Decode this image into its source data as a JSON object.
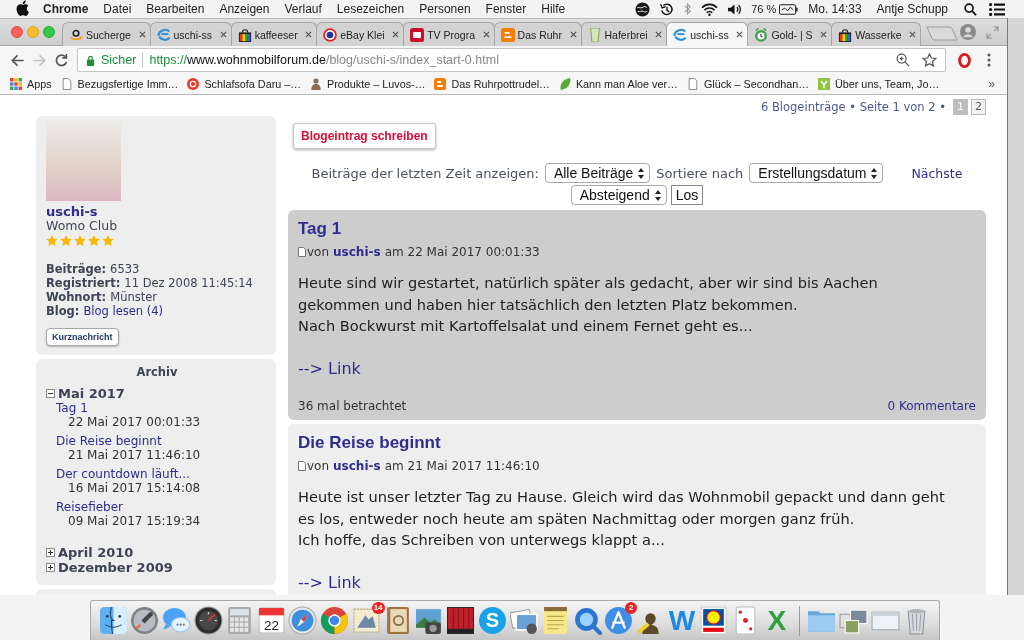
{
  "menu_bar": {
    "app": "Chrome",
    "menus": [
      "Datei",
      "Bearbeiten",
      "Anzeigen",
      "Verlauf",
      "Lesezeichen",
      "Personen",
      "Fenster",
      "Hilfe"
    ],
    "battery": "76 %",
    "clock": "Mo. 14:33",
    "user": "Antje Schupp"
  },
  "browser": {
    "tabs": [
      {
        "title": "Sucherge",
        "kind": "smile",
        "selected": false
      },
      {
        "title": "uschi-ss",
        "kind": "swirl",
        "selected": false
      },
      {
        "title": "kaffeeser",
        "kind": "bag",
        "selected": false
      },
      {
        "title": "eBay Klei",
        "kind": "ring",
        "selected": false
      },
      {
        "title": "TV Progra",
        "kind": "tv",
        "selected": false
      },
      {
        "title": "Das Ruhr",
        "kind": "blog",
        "selected": false
      },
      {
        "title": "Haferbrei",
        "kind": "cup",
        "selected": false
      },
      {
        "title": "uschi-ss",
        "kind": "swirl",
        "selected": true
      },
      {
        "title": "Gold- | S",
        "kind": "clock",
        "selected": false
      },
      {
        "title": "Wasserke",
        "kind": "bag",
        "selected": false
      }
    ],
    "nav_buttons": [
      {
        "kind": "back",
        "disabled": false
      },
      {
        "kind": "forward",
        "disabled": true
      },
      {
        "kind": "reload",
        "disabled": false
      }
    ],
    "address": {
      "security": "Sicher",
      "scheme": "https://",
      "host": "www.wohnmobilforum.de",
      "path": "/blog/uschi-s/index_start-0.html"
    },
    "bookmarks": [
      {
        "label": "Apps",
        "kind": "grid"
      },
      {
        "label": "Bezugsfertige Imm…",
        "kind": "page"
      },
      {
        "label": "Schlafsofa Daru –…",
        "kind": "badge"
      },
      {
        "label": "Produkte – Luvos-…",
        "kind": "figure"
      },
      {
        "label": "Das Ruhrpottrudel…",
        "kind": "blog"
      },
      {
        "label": "Kann man Aloe ver…",
        "kind": "leaf"
      },
      {
        "label": "Glück – Secondhan…",
        "kind": "page"
      },
      {
        "label": "Über uns, Team, Jo…",
        "kind": "tile"
      }
    ],
    "bookmarks_overflow": "»"
  },
  "page": {
    "pagination": {
      "summary": "6 Blogeinträge • Seite 1 von 2 •",
      "pages": [
        {
          "label": "1",
          "selected": true
        },
        {
          "label": "2",
          "selected": false
        }
      ]
    },
    "profile": {
      "username": "uschi-s",
      "rank": "Womo Club",
      "stars": 5,
      "facts": [
        {
          "label": "Beiträge:",
          "value": "6533",
          "kind": "text"
        },
        {
          "label": "Registriert:",
          "value": "11 Dez 2008 11:45:14",
          "kind": "text"
        },
        {
          "label": "Wohnort:",
          "value": "Münster",
          "kind": "text"
        },
        {
          "label": "Blog:",
          "value": "Blog lesen (4)",
          "kind": "link"
        }
      ],
      "message_button": "Kurznachricht"
    },
    "archive": {
      "title": "Archiv",
      "groups": [
        {
          "label": "Mai 2017",
          "expanded": true,
          "children": [
            {
              "title": "Tag 1",
              "date": "22 Mai 2017 00:01:33"
            },
            {
              "title": "Die Reise beginnt",
              "date": "21 Mai 2017 11:46:10"
            },
            {
              "title": "Der countdown läuft...",
              "date": "16 Mai 2017 15:14:08"
            },
            {
              "title": "Reisefieber",
              "date": "09 Mai 2017 15:19:34"
            }
          ]
        },
        {
          "label": "April 2010",
          "expanded": false
        },
        {
          "label": "Dezember 2009",
          "expanded": false
        }
      ]
    },
    "new_post_button": "Blogeintrag schreiben",
    "filters": {
      "period_label": "Beiträge der letzten Zeit anzeigen:",
      "period": "Alle Beiträge",
      "sort_label": "Sortiere nach",
      "sort": "Erstellungsdatum",
      "next": "Nächste",
      "order": "Absteigend",
      "submit": "Los"
    },
    "posts": [
      {
        "title": "Tag 1",
        "highlighted": true,
        "byline": {
          "prefix": "von",
          "author": "uschi-s",
          "date": "am 22 Mai 2017 00:01:33"
        },
        "excerpt": "Heute sind wir gestartet, natürlich später als gedacht, aber wir sind bis Aachen\ngekommen und haben hier tatsächlich den letzten Platz bekommen.\nNach Bockwurst mit Kartoffelsalat und einem Fernet geht es...",
        "link": "--> Link",
        "views": "36 mal betrachtet",
        "comments": "0 Kommentare"
      },
      {
        "title": "Die Reise beginnt",
        "highlighted": false,
        "byline": {
          "prefix": "von",
          "author": "uschi-s",
          "date": "am 21 Mai 2017 11:46:10"
        },
        "excerpt": "Heute ist unser letzter Tag zu Hause. Gleich wird das Wohnmobil gepackt und dann geht\nes los, entweder noch heute am späten Nachmittag oder morgen ganz früh.\nIch hoffe, das Schreiben von unterwegs klappt a...",
        "link": "--> Link"
      }
    ]
  },
  "dock": {
    "items": [
      {
        "kind": "face"
      },
      {
        "kind": "rocket"
      },
      {
        "kind": "bubbles"
      },
      {
        "kind": "gauge"
      },
      {
        "kind": "calculator"
      },
      {
        "kind": "calendar",
        "date": "22"
      },
      {
        "kind": "compass"
      },
      {
        "kind": "pinwheel"
      },
      {
        "kind": "stamp",
        "badge": "14"
      },
      {
        "kind": "book"
      },
      {
        "kind": "camera"
      },
      {
        "kind": "curtain"
      },
      {
        "kind": "disc",
        "glyph": "S"
      },
      {
        "kind": "photos"
      },
      {
        "kind": "notepad"
      },
      {
        "kind": "magnifier"
      },
      {
        "kind": "sticks",
        "badge": "2"
      },
      {
        "kind": "bust"
      },
      {
        "kind": "letter",
        "glyph": "W",
        "color": "#1e88e5"
      },
      {
        "kind": "logo"
      },
      {
        "kind": "cards"
      },
      {
        "kind": "letter",
        "glyph": "X",
        "color": "#2e9e3e"
      },
      {
        "kind": "separator"
      },
      {
        "kind": "folder"
      },
      {
        "kind": "stack"
      },
      {
        "kind": "window"
      },
      {
        "kind": "trash"
      }
    ]
  }
}
